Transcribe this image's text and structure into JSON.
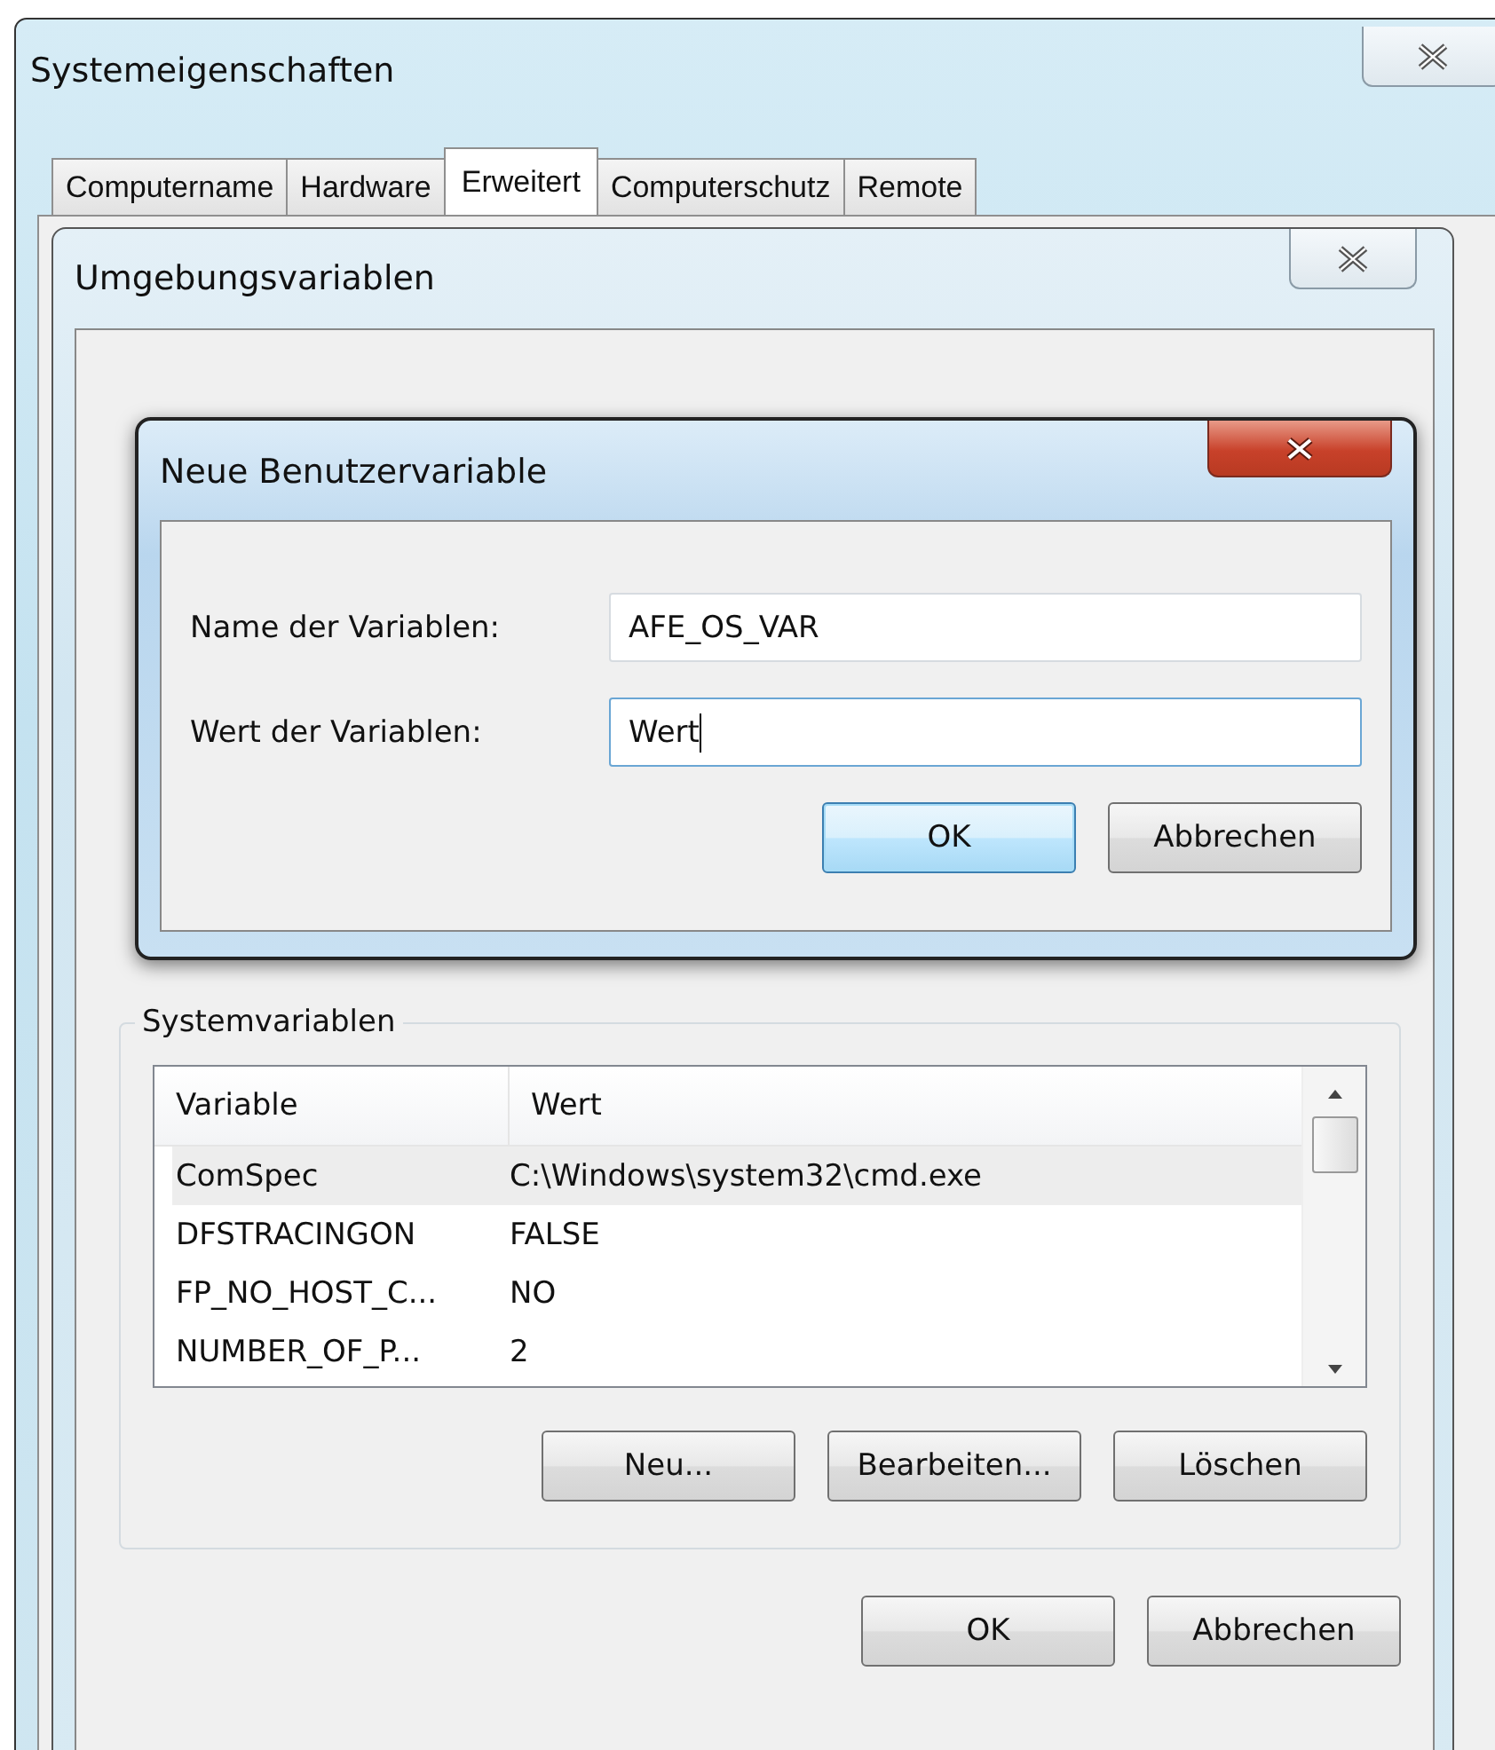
{
  "window": {
    "title": "Systemeigenschaften",
    "tabs": [
      {
        "label": "Computername",
        "selected": false
      },
      {
        "label": "Hardware",
        "selected": false
      },
      {
        "label": "Erweitert",
        "selected": true
      },
      {
        "label": "Computerschutz",
        "selected": false
      },
      {
        "label": "Remote",
        "selected": false
      }
    ]
  },
  "env_dialog": {
    "title": "Umgebungsvariablen",
    "system_variables": {
      "title": "Systemvariablen",
      "columns": [
        "Variable",
        "Wert"
      ],
      "rows": [
        {
          "variable": "ComSpec",
          "value": "C:\\Windows\\system32\\cmd.exe",
          "selected": true
        },
        {
          "variable": "DFSTRACINGON",
          "value": "FALSE",
          "selected": false
        },
        {
          "variable": "FP_NO_HOST_C...",
          "value": "NO",
          "selected": false
        },
        {
          "variable": "NUMBER_OF_P...",
          "value": "2",
          "selected": false
        }
      ],
      "buttons": [
        {
          "label": "Neu...",
          "default": false
        },
        {
          "label": "Bearbeiten...",
          "default": false
        },
        {
          "label": "Löschen",
          "default": false
        }
      ]
    },
    "buttons": [
      {
        "label": "OK",
        "default": false
      },
      {
        "label": "Abbrechen",
        "default": false
      }
    ]
  },
  "new_var_dialog": {
    "title": "Neue Benutzervariable",
    "fields": [
      {
        "label": "Name der Variablen:",
        "value": "AFE_OS_VAR",
        "focused": false
      },
      {
        "label": "Wert der Variablen:",
        "value": "Wert",
        "focused": true
      }
    ],
    "buttons": [
      {
        "label": "OK",
        "default": true
      },
      {
        "label": "Abbrechen",
        "default": false
      }
    ]
  }
}
